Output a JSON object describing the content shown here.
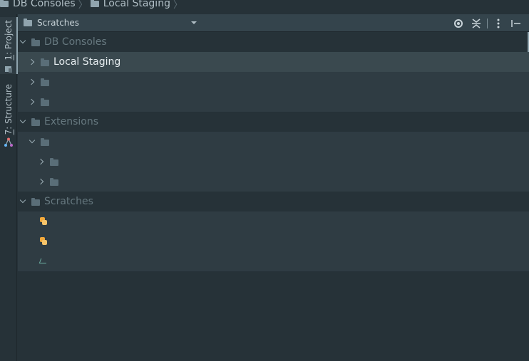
{
  "breadcrumb": {
    "items": [
      {
        "label": "DB Consoles",
        "icon": "folder-icon"
      },
      {
        "label": "Local Staging",
        "icon": "folder-icon"
      }
    ]
  },
  "tool_strip": {
    "project_tab": {
      "prefix": "1",
      "label": ": Project",
      "icon": "project-icon"
    },
    "structure_tab": {
      "prefix": "7",
      "label": ": Structure",
      "icon": "structure-icon"
    }
  },
  "header": {
    "title": "Scratches",
    "icon": "folder-icon",
    "tools": [
      "locate-icon",
      "collapse-all-icon",
      "more-icon",
      "hide-icon"
    ]
  },
  "tree": {
    "db_consoles": {
      "label": "DB Consoles",
      "expanded": true
    },
    "local_staging": {
      "label": "Local Staging",
      "selected": true
    },
    "extensions": {
      "label": "Extensions",
      "expanded": true
    },
    "scratches": {
      "label": "Scratches",
      "expanded": true
    }
  },
  "colors": {
    "background": "#263238",
    "header": "#34444c",
    "selected_row": "#3a494f",
    "child_row": "#2f3c43",
    "python_icon": "#f2a93b"
  }
}
